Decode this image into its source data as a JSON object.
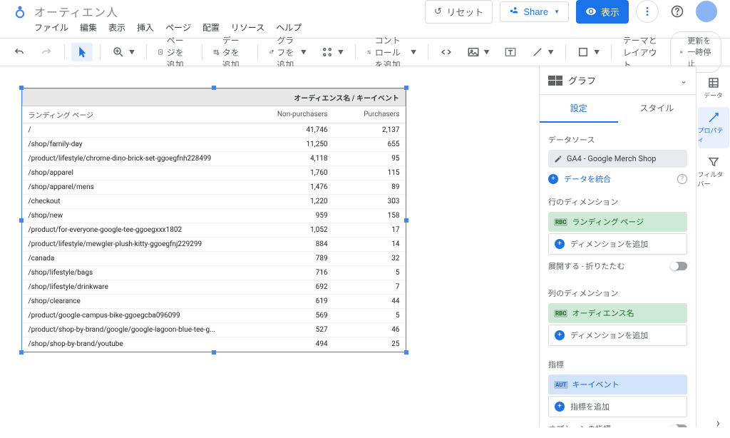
{
  "header": {
    "doc_title": "オーティエン人",
    "reset": "リセット",
    "share": "Share",
    "view": "表示"
  },
  "menu": [
    "ファイル",
    "編集",
    "表示",
    "挿入",
    "ページ",
    "配置",
    "リソース",
    "ヘルプ"
  ],
  "toolbar": {
    "add_page": "ページを追加",
    "add_data": "データを追加",
    "add_chart": "グラフを追加",
    "add_control": "コントロールを追加",
    "theme_layout": "テーマとレイアウト",
    "pause_update": "更新を一時停止"
  },
  "table": {
    "super_header": "オーディエンス名 / キーイベント",
    "columns": [
      "ランディング ページ",
      "Non-purchasers",
      "Purchasers"
    ],
    "rows": [
      {
        "page": "/",
        "np": "41,746",
        "p": "2,137"
      },
      {
        "page": "/shop/family-day",
        "np": "11,250",
        "p": "655"
      },
      {
        "page": "/product/lifestyle/chrome-dino-brick-set-ggoegfnh228499",
        "np": "4,118",
        "p": "95"
      },
      {
        "page": "/shop/apparel",
        "np": "1,760",
        "p": "115"
      },
      {
        "page": "/shop/apparel/mens",
        "np": "1,476",
        "p": "89"
      },
      {
        "page": "/checkout",
        "np": "1,220",
        "p": "303"
      },
      {
        "page": "/shop/new",
        "np": "959",
        "p": "158"
      },
      {
        "page": "/product/for-everyone-google-tee-ggoegxxx1802",
        "np": "1,052",
        "p": "17"
      },
      {
        "page": "/product/lifestyle/mewgler-plush-kitty-ggoegfnj229299",
        "np": "884",
        "p": "14"
      },
      {
        "page": "/canada",
        "np": "789",
        "p": "32"
      },
      {
        "page": "/shop/lifestyle/bags",
        "np": "716",
        "p": "5"
      },
      {
        "page": "/shop/lifestyle/drinkware",
        "np": "692",
        "p": "7"
      },
      {
        "page": "/shop/clearance",
        "np": "619",
        "p": "44"
      },
      {
        "page": "/product/google-campus-bike-ggoegcba096099",
        "np": "569",
        "p": "5"
      },
      {
        "page": "/product/shop-by-brand/google/google-lagoon-blue-tee-g...",
        "np": "527",
        "p": "46"
      },
      {
        "page": "/shop/shop-by-brand/youtube",
        "np": "494",
        "p": "25"
      }
    ]
  },
  "panel": {
    "title": "グラフ",
    "tabs": {
      "setup": "設定",
      "style": "スタイル"
    },
    "data_source": "データソース",
    "data_source_name": "GA4 - Google Merch Shop",
    "merge_data": "データを統合",
    "row_dimension": "行のディメンション",
    "landing_page": "ランディング ページ",
    "add_dimension": "ディメンションを追加",
    "expand_collapse": "展開する - 折りたたむ",
    "col_dimension": "列のディメンション",
    "audience_name": "オーディエンス名",
    "metric": "指標",
    "key_event": "キーイベント",
    "add_metric": "指標を追加",
    "optional_metric": "オプションの指標",
    "tag_abc": "RBC",
    "tag_aut": "AUT"
  },
  "rail": {
    "data": "データ",
    "property": "プロパティ",
    "filter": "フィルタバー"
  }
}
